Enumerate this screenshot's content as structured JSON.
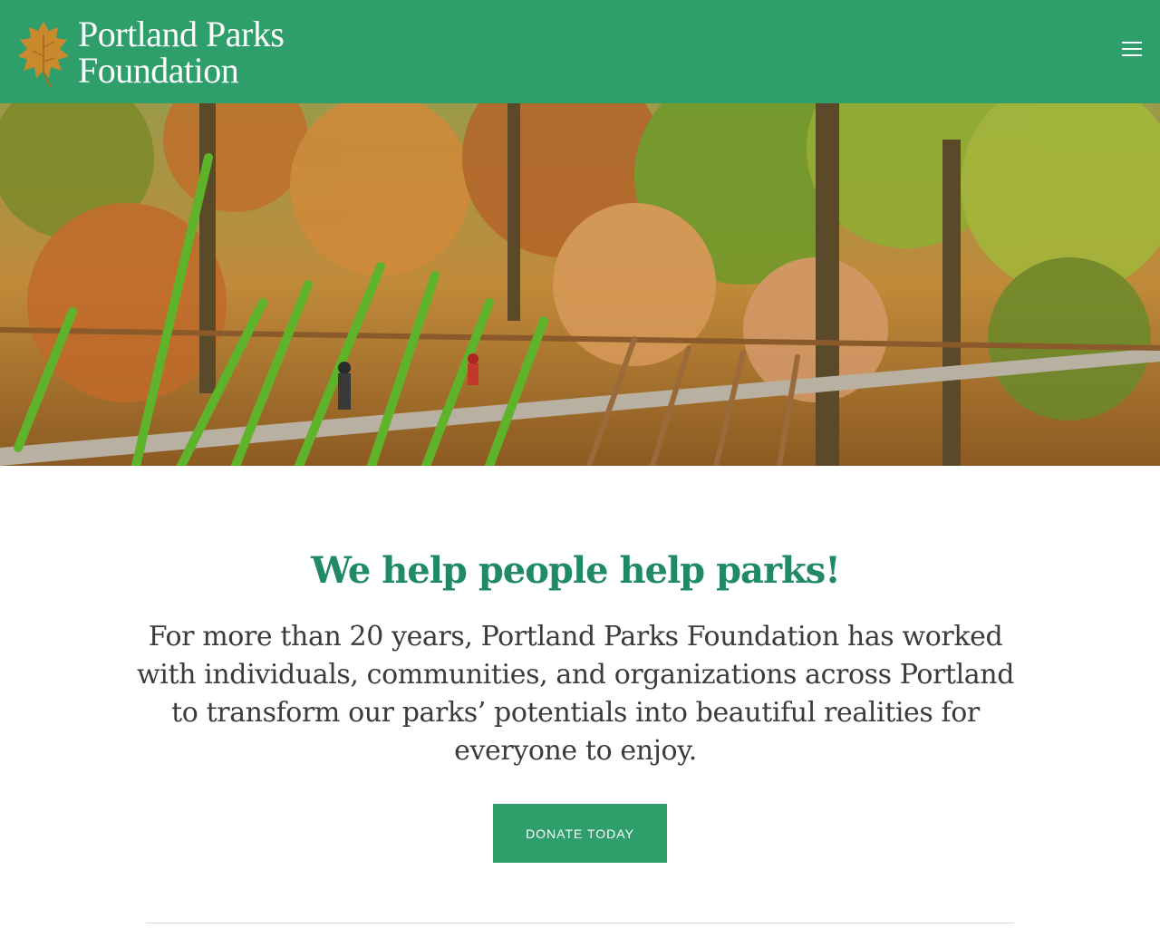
{
  "header": {
    "logo_line1": "Portland Parks",
    "logo_line2": "Foundation",
    "logo_icon": "leaf-icon",
    "menu_icon": "hamburger-menu-icon",
    "background_color": "#2e9e6b"
  },
  "hero": {
    "image_subject": "people crossing a suspension bridge through an autumn forest"
  },
  "main": {
    "headline": "We help people help parks!",
    "lede": "For more than 20 years, Portland Parks Foundation has worked with individuals, communities, and organizations across Portland to transform our parks’ potentials into beautiful realities for everyone to enjoy.",
    "donate_label": "DONATE TODAY"
  },
  "colors": {
    "brand_green": "#2e9e6b",
    "headline_green": "#1f8a63",
    "body_text": "#3b3b3b",
    "leaf_orange": "#c98a2e"
  }
}
